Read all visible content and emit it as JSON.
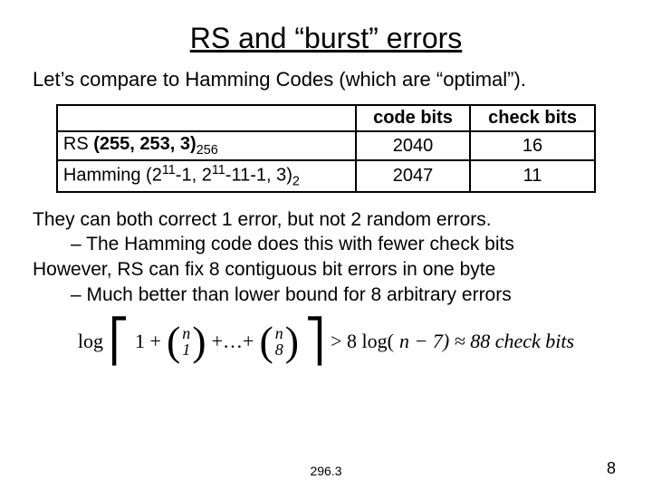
{
  "title": "RS and “burst” errors",
  "intro": "Let’s compare to Hamming Codes (which are “optimal”).",
  "table": {
    "headers": {
      "col1": "",
      "col2": "code bits",
      "col3": "check bits"
    },
    "rows": [
      {
        "label_prefix": "RS ",
        "label_bold": "(255, 253, 3)",
        "label_sub": "256",
        "code_bits": "2040",
        "check_bits": "16"
      },
      {
        "label_plain": "Hamming (2",
        "label_sup1": "11",
        "label_mid1": "-1, 2",
        "label_sup2": "11",
        "label_mid2": "-11-1, 3)",
        "label_sub2": "2",
        "code_bits": "2047",
        "check_bits": "11"
      }
    ]
  },
  "body": {
    "line1": "They can both correct 1 error, but not 2 random errors.",
    "line2": "– The Hamming code does this with fewer check bits",
    "line3": "However, RS can fix 8 contiguous bit errors in one byte",
    "line4": "– Much better than lower bound for 8 arbitrary errors"
  },
  "formula": {
    "log": "log",
    "one_plus": "1 +",
    "n": "n",
    "one": "1",
    "plus_dots": "+…+",
    "eight": "8",
    "gt": "> 8 log(",
    "nminus7": "n − 7) ≈ 88 check bits"
  },
  "footer": {
    "center": "296.3",
    "right": "8"
  }
}
